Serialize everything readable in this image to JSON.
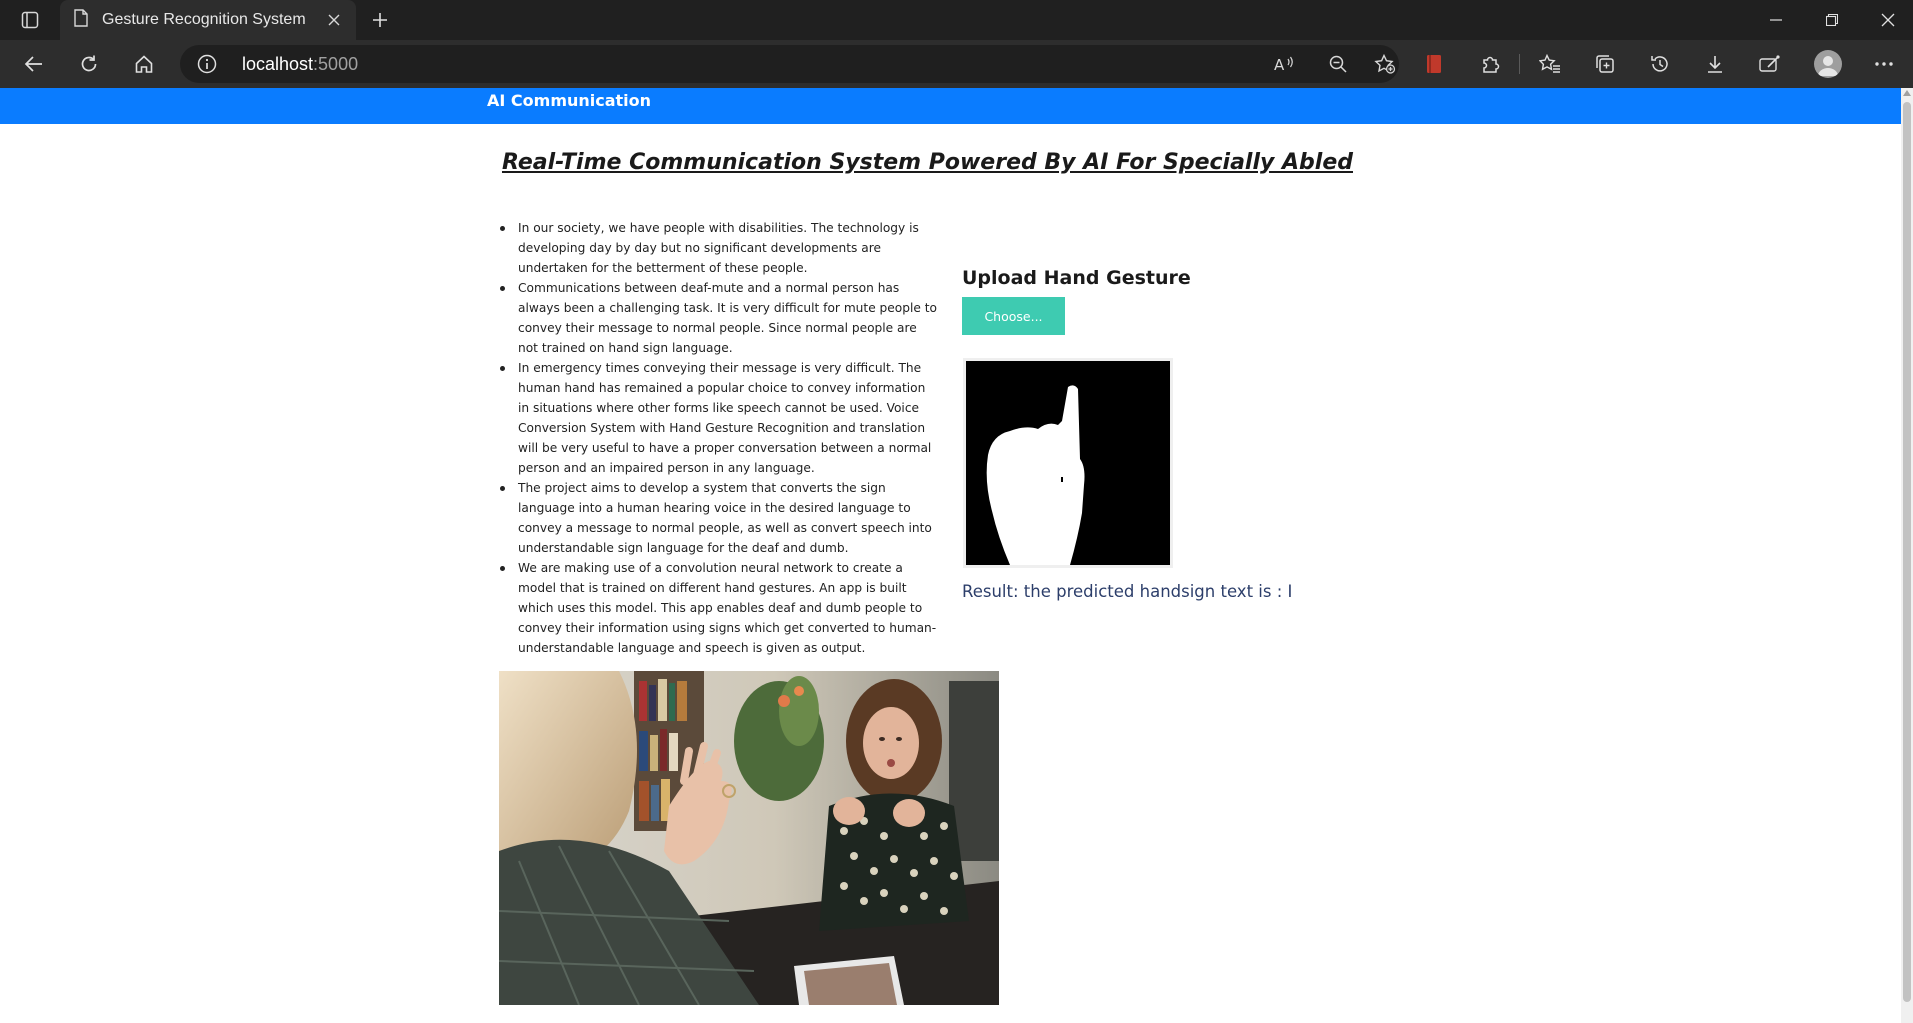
{
  "browser": {
    "tab_title": "Gesture Recognition System",
    "url_host": "localhost",
    "url_port": ":5000"
  },
  "page": {
    "brand": "AI Communication",
    "heading": "Real-Time Communication System Powered By AI For Specially Abled",
    "bullets": [
      "In our society, we have people with disabilities. The technology is developing day by day but no significant developments are undertaken for the betterment of these people.",
      "Communications between deaf-mute and a normal person has always been a challenging task. It is very difficult for mute people to convey their message to normal people. Since normal people are not trained on hand sign language.",
      "In emergency times conveying their message is very difficult. The human hand has remained a popular choice to convey information in situations where other forms like speech cannot be used. Voice Conversion System with Hand Gesture Recognition and translation will be very useful to have a proper conversation between a normal person and an impaired person in any language.",
      "The project aims to develop a system that converts the sign language into a human hearing voice in the desired language to convey a message to normal people, as well as convert speech into understandable sign language for the deaf and dumb.",
      "We are making use of a convolution neural network to create a model that is trained on different hand gestures. An app is built which uses this model. This app enables deaf and dumb people to convey their information using signs which get converted to human-understandable language and speech is given as output."
    ],
    "upload": {
      "title": "Upload Hand Gesture",
      "choose_label": "Choose...",
      "result_text": "Result: the predicted handsign text is : I"
    }
  },
  "colors": {
    "navbar": "#0a7cff",
    "choose_button": "#3ecbb1",
    "result_text": "#2c3e6a"
  }
}
